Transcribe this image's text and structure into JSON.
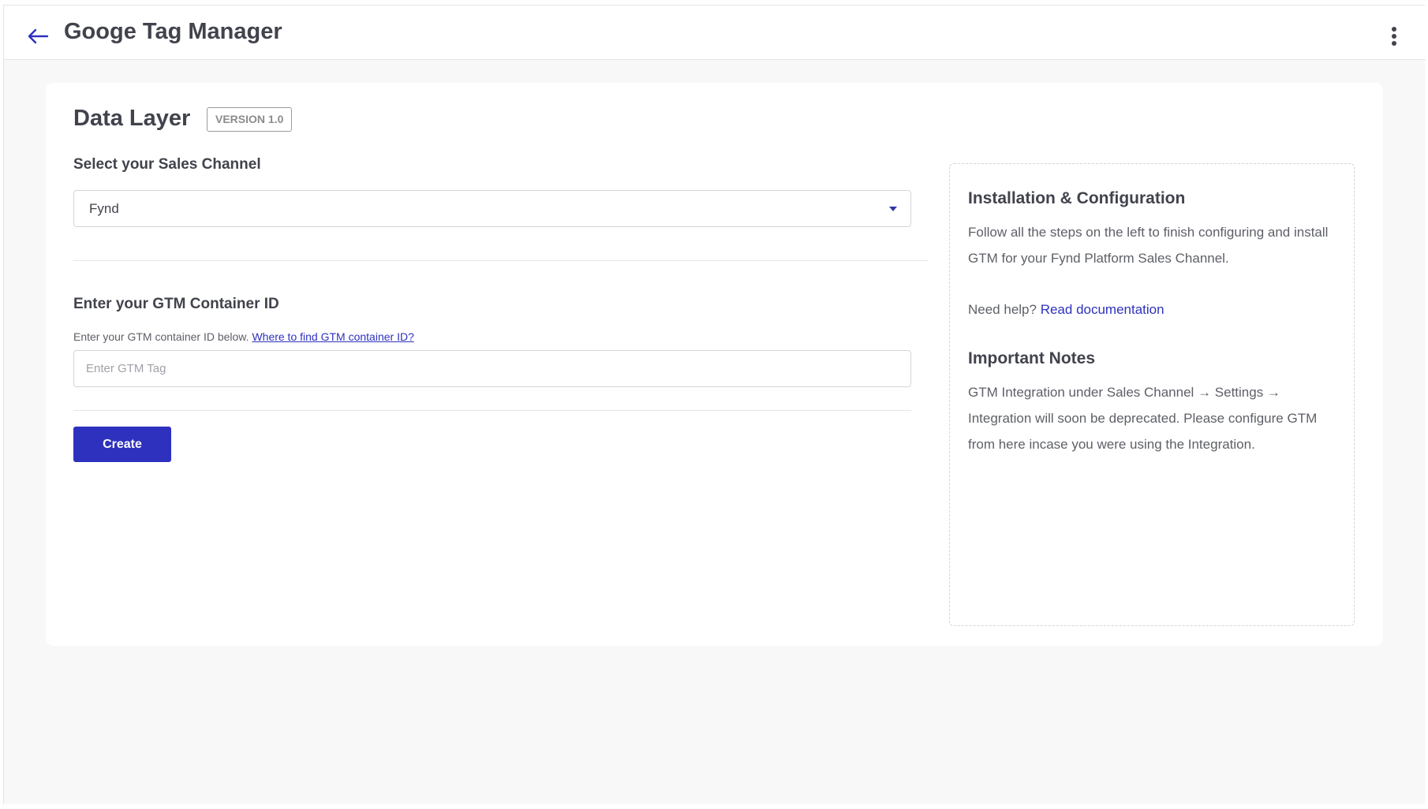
{
  "header": {
    "title": "Googe Tag Manager",
    "back_icon": "arrow-left-icon",
    "menu_icon": "more-vertical-icon"
  },
  "page": {
    "title": "Data Layer",
    "version_badge": "VERSION 1.0"
  },
  "sales_channel": {
    "label": "Select your Sales Channel",
    "selected_value": "Fynd"
  },
  "gtm": {
    "label": "Enter your GTM Container ID",
    "helper_text": "Enter your GTM container ID below.",
    "helper_link": "Where to find GTM container ID?",
    "input_value": "",
    "input_placeholder": "Enter GTM Tag"
  },
  "actions": {
    "create_label": "Create"
  },
  "info": {
    "install_heading": "Installation & Configuration",
    "install_text": "Follow all the steps on the left to finish configuring and install GTM for your Fynd Platform Sales Channel.",
    "help_prefix": "Need help?",
    "help_link": "Read documentation",
    "notes_heading": "Important Notes",
    "notes_text": "GTM Integration under Sales Channel → Settings → Integration will soon be deprecated. Please configure GTM from here incase you were using the Integration."
  },
  "colors": {
    "accent": "#2e31be",
    "text": "#41434c",
    "background": "#f8f8f8"
  }
}
